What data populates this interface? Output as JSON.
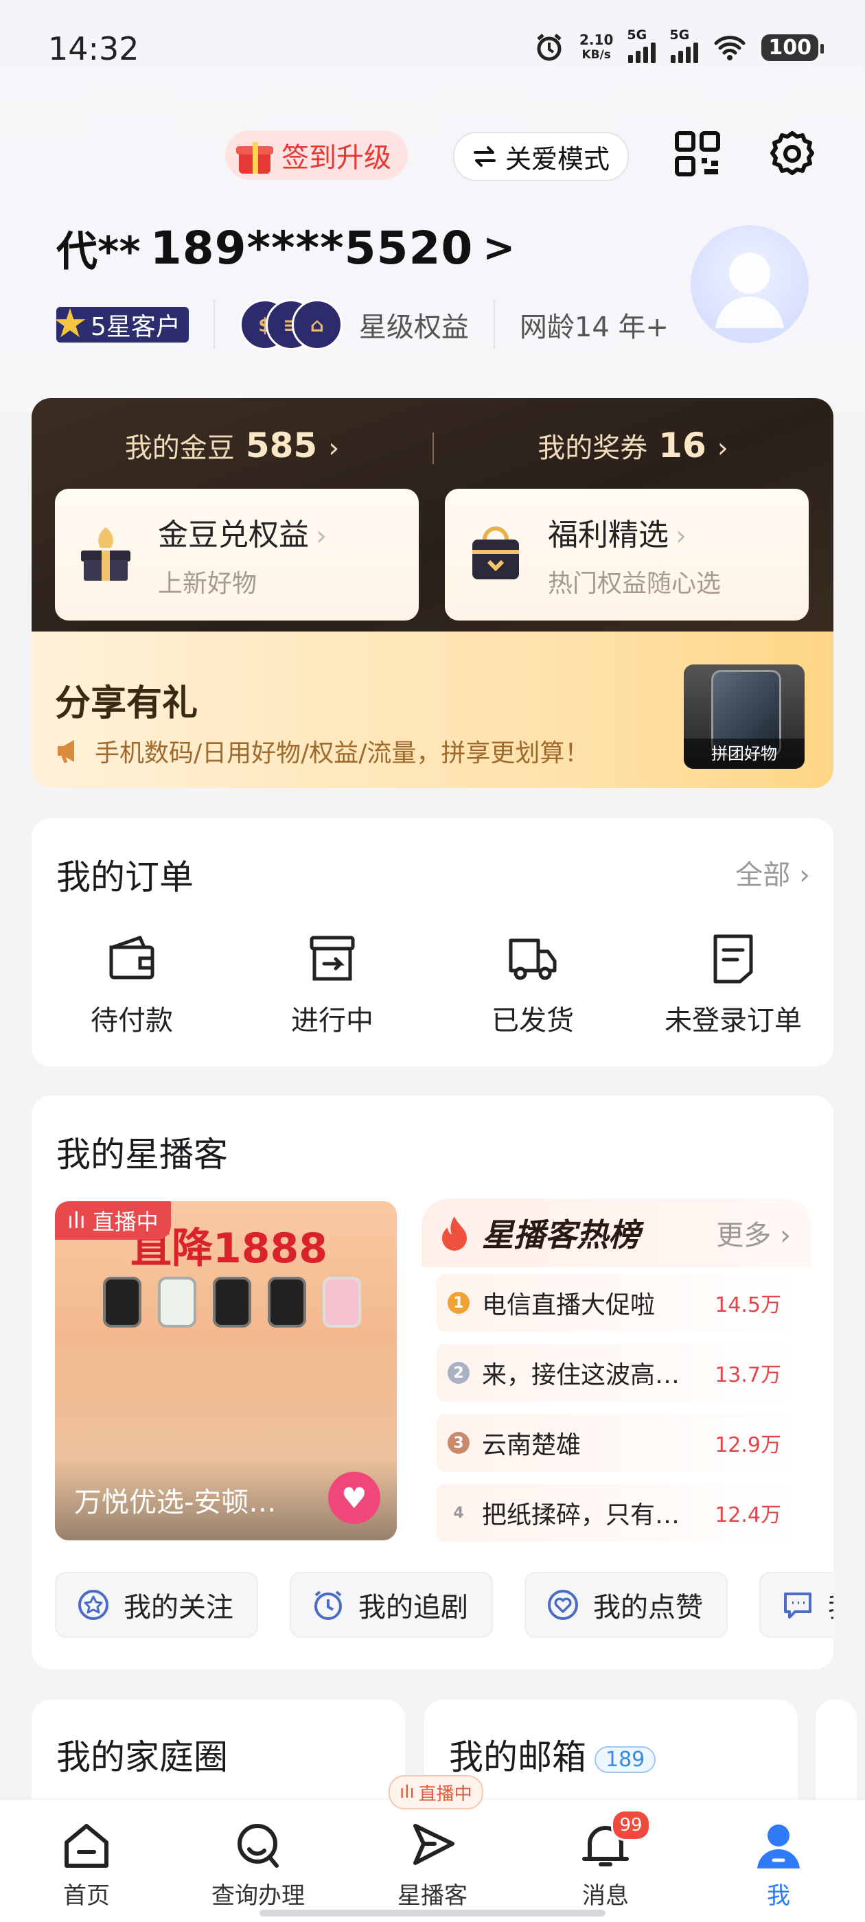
{
  "status_bar": {
    "time": "14:32",
    "speed_value": "2.10",
    "speed_unit": "KB/s",
    "net1": "5G",
    "net2": "5G",
    "battery": "100"
  },
  "header": {
    "signin_label": "签到升级",
    "care_mode_label": "关爱模式"
  },
  "user": {
    "name": "代**",
    "phone": "189****5520",
    "chevron": ">",
    "level_badge": "5星客户",
    "benefits_label": "星级权益",
    "network_age": "网龄14 年+"
  },
  "gold": {
    "beans_label": "我的金豆",
    "beans_value": "585",
    "coupons_label": "我的奖券",
    "coupons_value": "16",
    "card1_title": "金豆兑权益",
    "card1_sub": "上新好物",
    "card2_title": "福利精选",
    "card2_sub": "热门权益随心选"
  },
  "share": {
    "title": "分享有礼",
    "subtitle": "手机数码/日用好物/权益/流量，拼享更划算！",
    "image_caption": "拼团好物"
  },
  "orders": {
    "title": "我的订单",
    "all_label": "全部",
    "items": [
      {
        "label": "待付款",
        "icon": "wallet-icon"
      },
      {
        "label": "进行中",
        "icon": "box-arrow-icon"
      },
      {
        "label": "已发货",
        "icon": "truck-icon"
      },
      {
        "label": "未登录订单",
        "icon": "document-icon"
      }
    ]
  },
  "broadcast": {
    "title": "我的星播客",
    "live_tag": "直播中",
    "live_banner": "直降1888",
    "live_caption": "万悦优选-安顿…",
    "hot_title": "星播客热榜",
    "hot_more": "更多",
    "hot_list": [
      {
        "rank": "1",
        "title": "电信直播大促啦",
        "value": "14.5万"
      },
      {
        "rank": "2",
        "title": "来，接住这波高速…",
        "value": "13.7万"
      },
      {
        "rank": "3",
        "title": "云南楚雄",
        "value": "12.9万"
      },
      {
        "rank": "4",
        "title": "把纸揉碎，只有经…",
        "value": "12.4万"
      }
    ],
    "chips": [
      {
        "label": "我的关注",
        "icon": "star-icon"
      },
      {
        "label": "我的追剧",
        "icon": "clock-icon"
      },
      {
        "label": "我的点赞",
        "icon": "heart-icon"
      },
      {
        "label": "我的评论",
        "icon": "comment-icon"
      }
    ]
  },
  "family": {
    "title": "我的家庭圈"
  },
  "mail": {
    "title": "我的邮箱",
    "tag": "189"
  },
  "nav": {
    "items": [
      {
        "label": "首页"
      },
      {
        "label": "查询办理"
      },
      {
        "label": "星播客"
      },
      {
        "label": "消息"
      },
      {
        "label": "我"
      }
    ],
    "live_pill": "直播中",
    "message_badge": "99"
  },
  "colors": {
    "accent": "#2f7af8",
    "red": "#e53935",
    "gold_dark": "#2a201a"
  }
}
